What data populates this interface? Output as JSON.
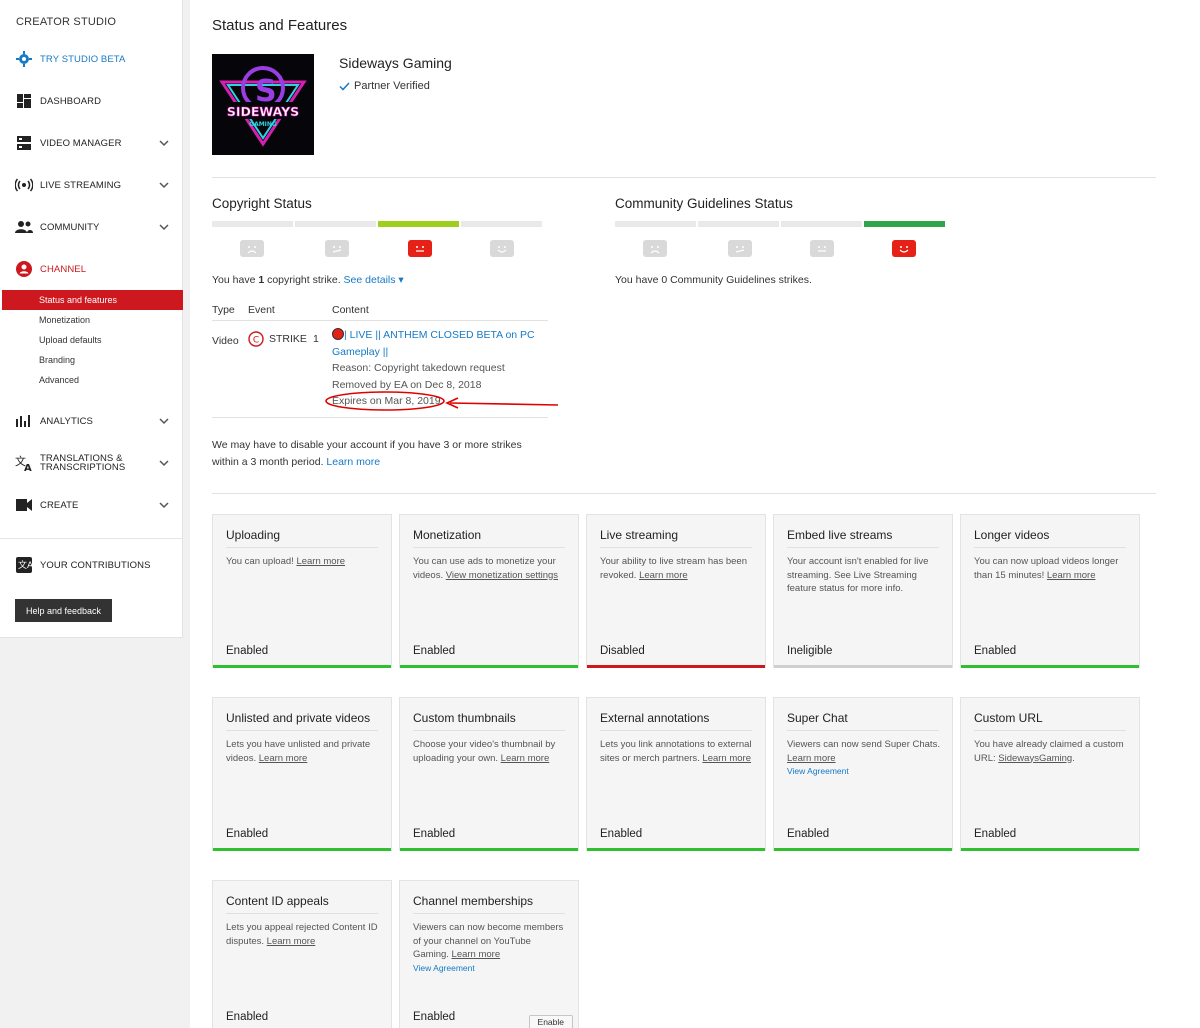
{
  "sidebar": {
    "title": "CREATOR STUDIO",
    "try_beta": "TRY STUDIO BETA",
    "dashboard": "DASHBOARD",
    "video_manager": "VIDEO MANAGER",
    "live_streaming": "LIVE STREAMING",
    "community": "COMMUNITY",
    "channel": "CHANNEL",
    "channel_sub": [
      "Status and features",
      "Monetization",
      "Upload defaults",
      "Branding",
      "Advanced"
    ],
    "analytics": "ANALYTICS",
    "translations_1": "TRANSLATIONS &",
    "translations_2": "TRANSCRIPTIONS",
    "create": "CREATE",
    "contributions": "YOUR CONTRIBUTIONS",
    "help": "Help and feedback"
  },
  "page": {
    "title": "Status and Features",
    "channel_name": "Sideways Gaming",
    "partner": "Partner Verified",
    "logo_text": "SIDEWAYS",
    "logo_sub": "GAMING"
  },
  "copyright": {
    "title": "Copyright Status",
    "strikes_pre": "You have ",
    "strikes_count": "1",
    "strikes_post": " copyright strike. ",
    "see_details": "See details ▾",
    "col_type": "Type",
    "col_event": "Event",
    "col_content": "Content",
    "row_type": "Video",
    "row_event": "STRIKE",
    "row_event_num": "1",
    "content_title": "| LIVE || ANTHEM CLOSED BETA on PC Gameplay ||",
    "reason": "Reason: Copyright takedown request",
    "removed": "Removed by EA on Dec 8, 2018",
    "expires": "Expires on Mar 8, 2019",
    "warning": "We may have to disable your account if you have 3 or more strikes within a 3 month period. ",
    "learn_more": "Learn more"
  },
  "community": {
    "title": "Community Guidelines Status",
    "text": "You have 0 Community Guidelines strikes."
  },
  "colors": {
    "accent": "#167ac6",
    "red": "#cc181e",
    "green": "#2fbf2f",
    "lime": "#9fce1c"
  },
  "cards": [
    {
      "title": "Uploading",
      "desc": "You can upload! ",
      "link": "Learn more",
      "status": "Enabled",
      "bar": "green"
    },
    {
      "title": "Monetization",
      "desc": "You can use ads to monetize your videos. ",
      "link": "View monetization settings",
      "status": "Enabled",
      "bar": "green"
    },
    {
      "title": "Live streaming",
      "desc": "Your ability to live stream has been revoked. ",
      "link": "Learn more",
      "status": "Disabled",
      "bar": "red"
    },
    {
      "title": "Embed live streams",
      "desc": "Your account isn't enabled for live streaming. See Live Streaming feature status for more info.",
      "link": "",
      "status": "Ineligible",
      "bar": "grey"
    },
    {
      "title": "Longer videos",
      "desc": "You can now upload videos longer than 15 minutes! ",
      "link": "Learn more",
      "status": "Enabled",
      "bar": "green"
    },
    {
      "title": "Unlisted and private videos",
      "desc": "Lets you have unlisted and private videos. ",
      "link": "Learn more",
      "status": "Enabled",
      "bar": "green"
    },
    {
      "title": "Custom thumbnails",
      "desc": "Choose your video's thumbnail by uploading your own. ",
      "link": "Learn more",
      "status": "Enabled",
      "bar": "green"
    },
    {
      "title": "External annotations",
      "desc": "Lets you link annotations to external sites or merch partners. ",
      "link": "Learn more",
      "status": "Enabled",
      "bar": "green"
    },
    {
      "title": "Super Chat",
      "desc": "Viewers can now send Super Chats. ",
      "link": "Learn more",
      "extra_link": "View Agreement",
      "status": "Enabled",
      "bar": "green"
    },
    {
      "title": "Custom URL",
      "desc": "You have already claimed a custom URL: ",
      "link": "SidewaysGaming",
      "suffix": ".",
      "status": "Enabled",
      "bar": "green"
    },
    {
      "title": "Content ID appeals",
      "desc": "Lets you appeal rejected Content ID disputes. ",
      "link": "Learn more",
      "status": "Enabled",
      "bar": "green"
    },
    {
      "title": "Channel memberships",
      "desc": "Viewers can now become members of your channel on YouTube Gaming. ",
      "link": "Learn more",
      "extra_link": "View Agreement",
      "status": "Enabled",
      "bar": "none",
      "button": "Enable"
    }
  ]
}
